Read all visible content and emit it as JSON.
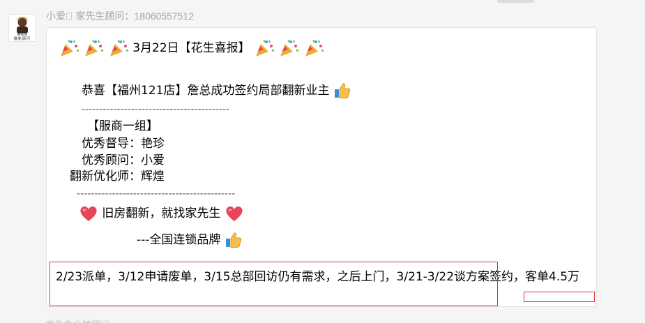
{
  "message": {
    "sender": "小爱\u0000 家先生顾问：18060557512",
    "avatar_text_top": "家先生",
    "avatar_text_bottom": "翻新顾问",
    "headline": "3月22日【花生喜报】",
    "congrats": "恭喜【福州121店】詹总成功签约局部翻新业主",
    "divider_1": "------------------------------------------",
    "group": "【服商一组】",
    "supervisor": "优秀督导：艳珍",
    "consultant": "优秀顾问：小爱",
    "optimizer": "翻新优化师：辉煌",
    "divider_2": "---------------------------------------------",
    "slogan": "旧房翻新，就找家先生",
    "brand": "---全国连锁品牌",
    "timeline": "2/23派单，3/12申请废单，3/15总部回访仍有需求，之后上门，3/21-3/22谈方案签约，客单4.5万"
  },
  "next_message": {
    "sender": "家先生金牌顾问…"
  },
  "icons": {
    "party": "party-popper-icon",
    "thumbs": "thumbs-up-icon",
    "heart": "red-heart-icon"
  },
  "colors": {
    "annotation_red": "#e0312f",
    "sender_gray": "#a6a6a6",
    "heart_red": "#e8445a"
  }
}
